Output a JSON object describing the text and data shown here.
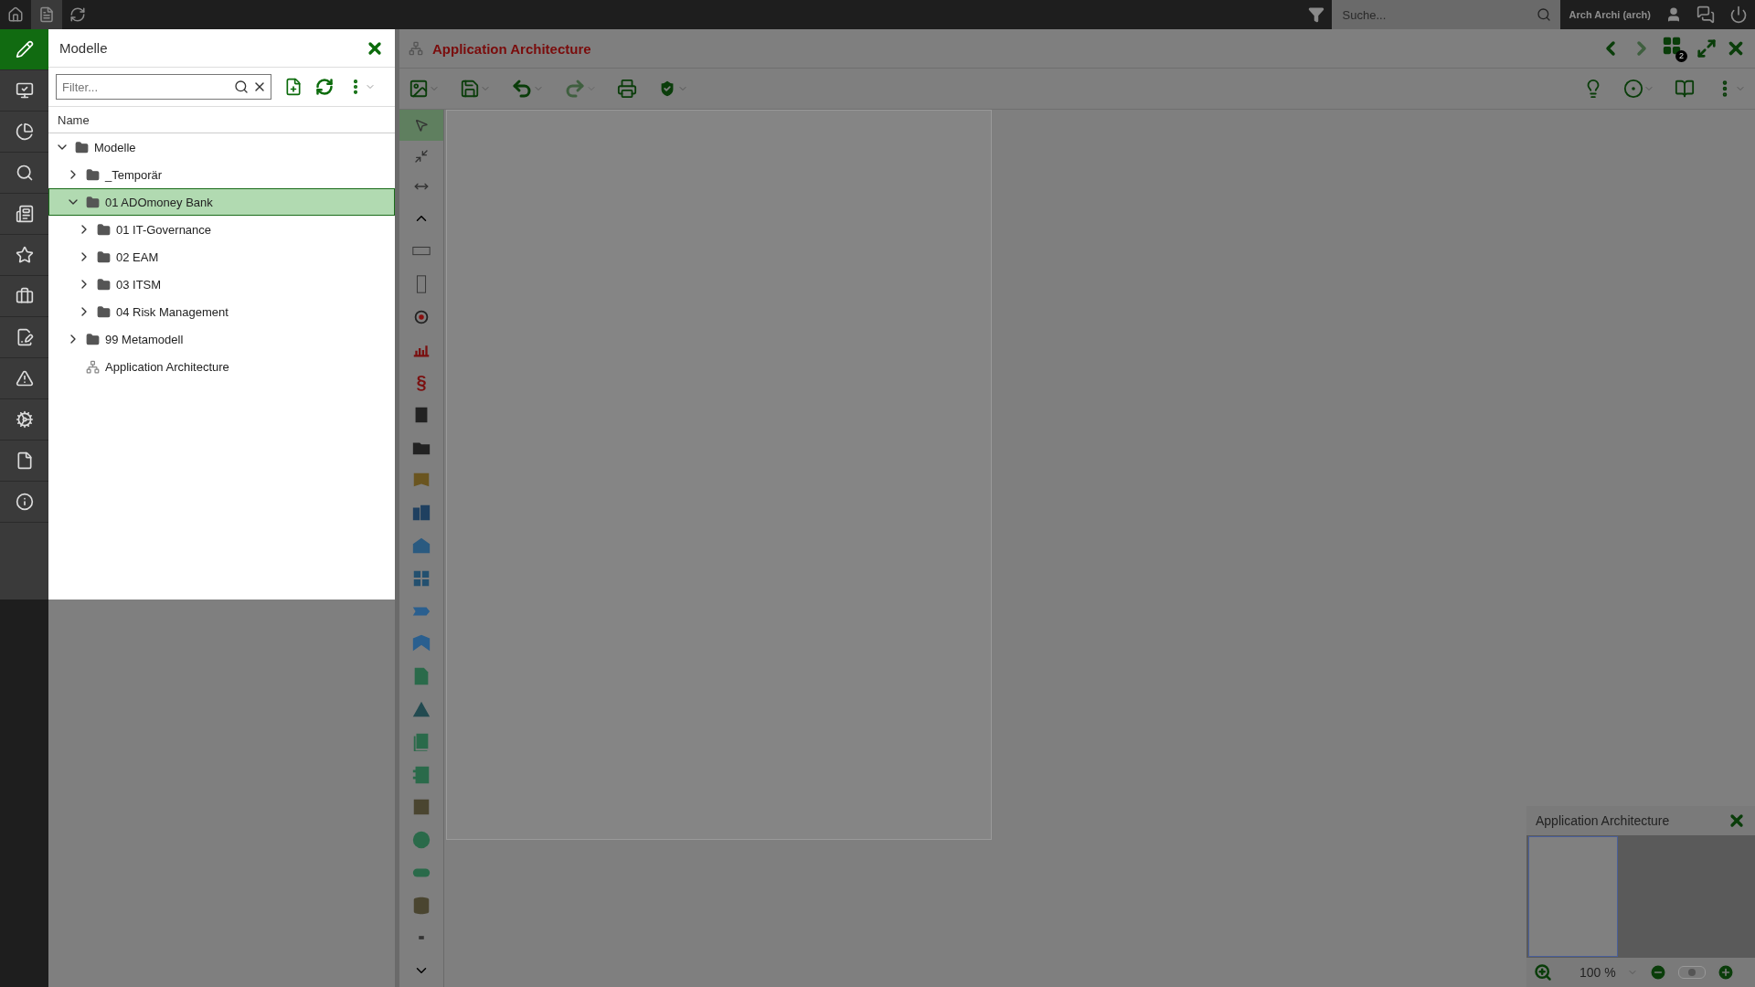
{
  "topbar": {
    "tabs": [
      {
        "selected": false
      },
      {
        "selected": true
      },
      {
        "selected": false
      }
    ],
    "search": {
      "placeholder": "Suche..."
    },
    "user": "Arch Archi (arch)"
  },
  "nav": [
    {
      "selected": true
    },
    {
      "selected": false
    },
    {
      "selected": false
    },
    {
      "selected": false
    },
    {
      "selected": false
    },
    {
      "selected": false
    },
    {
      "selected": false
    },
    {
      "selected": false
    },
    {
      "selected": false
    },
    {
      "selected": false
    },
    {
      "selected": false
    },
    {
      "selected": false
    }
  ],
  "panel": {
    "title": "Modelle",
    "filter": {
      "placeholder": "Filter..."
    },
    "column": "Name",
    "tree": [
      {
        "label": "Modelle",
        "kind": "folder",
        "expanded": true,
        "selected": false,
        "children": [
          {
            "label": "_Temporär",
            "kind": "folder",
            "expanded": false,
            "selected": false
          },
          {
            "label": "01 ADOmoney Bank",
            "kind": "folder",
            "expanded": true,
            "selected": true,
            "children": [
              {
                "label": "01 IT-Governance",
                "kind": "folder",
                "expanded": false,
                "selected": false
              },
              {
                "label": "02 EAM",
                "kind": "folder",
                "expanded": false,
                "selected": false
              },
              {
                "label": "03 ITSM",
                "kind": "folder",
                "expanded": false,
                "selected": false
              },
              {
                "label": "04 Risk Management",
                "kind": "folder",
                "expanded": false,
                "selected": false
              }
            ]
          },
          {
            "label": "99 Metamodell",
            "kind": "folder",
            "expanded": false,
            "selected": false
          },
          {
            "label": "Application Architecture",
            "kind": "model",
            "selected": false
          }
        ]
      }
    ]
  },
  "editor": {
    "title": "Application Architecture",
    "open_windows": "2",
    "palette_symbol": "§",
    "palette": [
      {
        "selected": true
      },
      {
        "selected": false
      },
      {
        "selected": false
      }
    ]
  },
  "minimap": {
    "title": "Application Architecture",
    "zoom": "100 %",
    "slider": {
      "level": 0.5
    }
  }
}
